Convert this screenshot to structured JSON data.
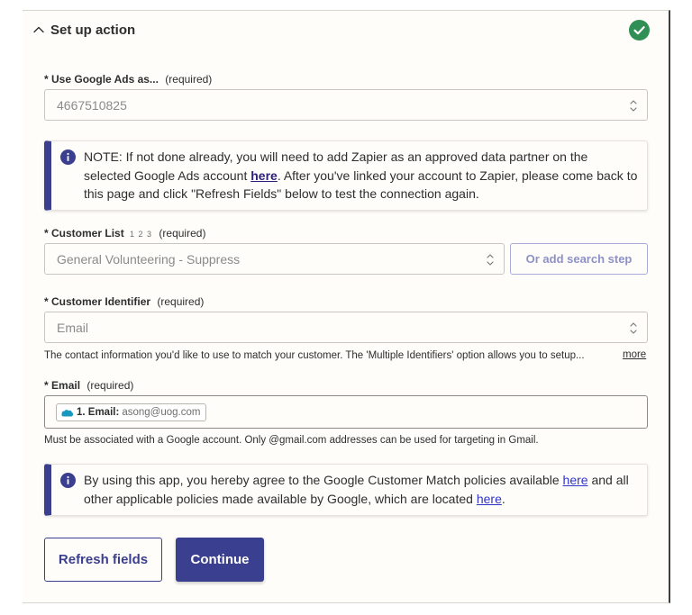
{
  "colors": {
    "accent": "#3b3f8f",
    "success": "#2f8f54",
    "link": "#2f33c8",
    "note_border": "#3b3f8f"
  },
  "header": {
    "title": "Set up action",
    "collapse_icon": "chevron-up-icon",
    "status_icon": "check-circle-icon"
  },
  "fields": {
    "account": {
      "asterisk": "*",
      "label": "Use Google Ads as...",
      "required": "(required)",
      "value": "4667510825"
    },
    "customer_list": {
      "asterisk": "*",
      "label": "Customer List",
      "numbers": "1 2 3",
      "required": "(required)",
      "value": "General Volunteering - Suppress",
      "search_button": "Or add search step"
    },
    "identifier": {
      "asterisk": "*",
      "label": "Customer Identifier",
      "required": "(required)",
      "value": "Email",
      "helper": "The contact information you'd like to use to match your customer. The 'Multiple Identifiers' option allows you to setup...",
      "more": "more"
    },
    "email": {
      "asterisk": "*",
      "label": "Email",
      "required": "(required)",
      "pill_key": "1. Email:",
      "pill_value": "asong@uog.com",
      "pill_icon": "salesforce-icon",
      "helper": "Must be associated with a Google account. Only @gmail.com addresses can be used for targeting in Gmail."
    }
  },
  "note1": {
    "icon": "info-icon",
    "text_a": "NOTE: If not done already, you will need to add Zapier as an approved data partner on the selected Google Ads account ",
    "link": "here",
    "text_b": ". After you've linked your account to Zapier, please come back to this page and click \"Refresh Fields\" below to test the connection again."
  },
  "note2": {
    "icon": "info-icon",
    "text_a": "By using this app, you hereby agree to the Google Customer Match policies available ",
    "link1": "here",
    "text_b": " and all other applicable policies made available by Google, which are located ",
    "link2": "here",
    "text_c": "."
  },
  "buttons": {
    "refresh": "Refresh fields",
    "continue": "Continue"
  }
}
